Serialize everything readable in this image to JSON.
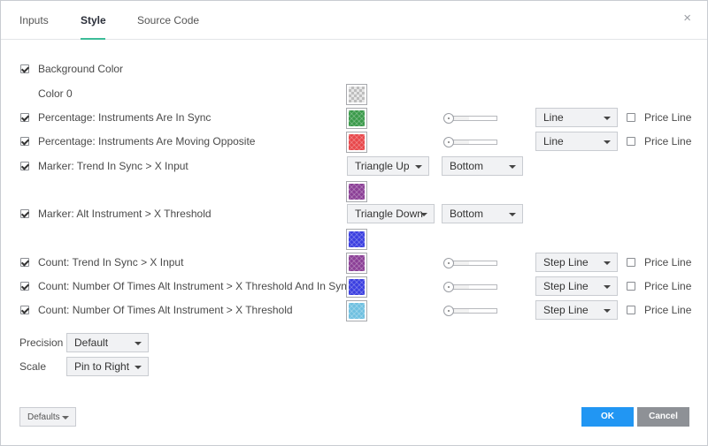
{
  "tabs": {
    "inputs": "Inputs",
    "style": "Style",
    "source": "Source Code"
  },
  "close_glyph": "×",
  "rows": {
    "background": {
      "label": "Background Color",
      "checked": true
    },
    "color0": {
      "label": "Color 0",
      "swatch": "checker"
    },
    "pct_sync": {
      "label": "Percentage: Instruments Are In Sync",
      "checked": true,
      "color": "#3a9a4a",
      "style": "Line",
      "price_line": "Price Line"
    },
    "pct_opp": {
      "label": "Percentage: Instruments Are Moving Opposite",
      "checked": true,
      "color": "#e8474a",
      "style": "Line",
      "price_line": "Price Line"
    },
    "marker_sync": {
      "label": "Marker: Trend In Sync > X Input",
      "checked": true,
      "shape": "Triangle Up",
      "location": "Bottom",
      "color": "#8b3f96"
    },
    "marker_alt": {
      "label": "Marker: Alt Instrument > X Threshold",
      "checked": true,
      "shape": "Triangle Down",
      "location": "Bottom",
      "color": "#3a3ee0"
    },
    "count_sync": {
      "label": "Count: Trend In Sync > X Input",
      "checked": true,
      "color": "#8b3f96",
      "style": "Step Line",
      "price_line": "Price Line"
    },
    "count_times_sync": {
      "label": "Count: Number Of Times Alt Instrument > X Threshold And In Sync",
      "checked": true,
      "color": "#3a3ee0",
      "style": "Step Line",
      "price_line": "Price Line"
    },
    "count_times": {
      "label": "Count: Number Of Times Alt Instrument > X Threshold",
      "checked": true,
      "color": "#6fc0e0",
      "style": "Step Line",
      "price_line": "Price Line"
    }
  },
  "precision": {
    "label": "Precision",
    "value": "Default"
  },
  "scale": {
    "label": "Scale",
    "value": "Pin to Right"
  },
  "footer": {
    "defaults": "Defaults",
    "ok": "OK",
    "cancel": "Cancel"
  }
}
